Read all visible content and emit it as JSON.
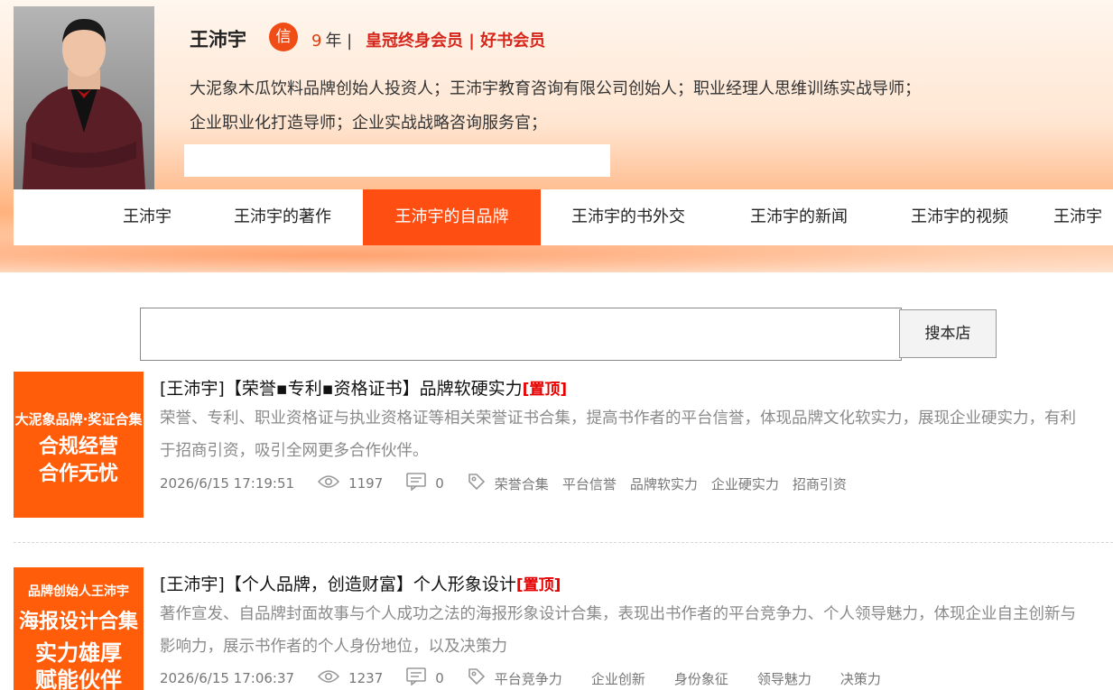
{
  "profile": {
    "name": "王沛宇",
    "credit_badge": "信",
    "years_num": "9",
    "years_unit": "年 |",
    "membership": "皇冠终身会员 | 好书会员",
    "bio_line1": "大泥象木瓜饮料品牌创始人投资人；王沛宇教育咨询有限公司创始人；职业经理人思维训练实战导师；",
    "bio_line2": "企业职业化打造导师；企业实战战略咨询服务官；"
  },
  "nav": {
    "tabs": [
      {
        "label": "王沛宇"
      },
      {
        "label": "王沛宇的著作"
      },
      {
        "label": "王沛宇的自品牌"
      },
      {
        "label": "王沛宇的书外交"
      },
      {
        "label": "王沛宇的新闻"
      },
      {
        "label": "王沛宇的视频"
      },
      {
        "label": "王沛宇"
      }
    ],
    "active_index": 2
  },
  "search": {
    "value": "",
    "button_label": "搜本店"
  },
  "items": [
    {
      "thumb_line1": "大泥象品牌·奖证合集",
      "thumb_line2": "合规经营",
      "thumb_line3": "合作无忧",
      "title": "[王沛宇]【荣誉▪专利▪资格证书】品牌软硬实力",
      "pin": "[置顶]",
      "desc": "荣誉、专利、职业资格证与执业资格证等相关荣誉证书合集，提高书作者的平台信誉，体现品牌文化软实力，展现企业硬实力，有利于招商引资，吸引全网更多合作伙伴。",
      "date": "2026/6/15 17:19:51",
      "views": "1197",
      "comments": "0",
      "tags": [
        "荣誉合集",
        "平台信誉",
        "品牌软实力",
        "企业硬实力",
        "招商引资"
      ]
    },
    {
      "thumb_line1": "品牌创始人王沛宇",
      "thumb_line2": "海报设计合集",
      "thumb_line3": "实力雄厚",
      "thumb_line4": "赋能伙伴",
      "title": "[王沛宇]【个人品牌，创造财富】个人形象设计",
      "pin": "[置顶]",
      "desc": "著作宣发、自品牌封面故事与个人成功之法的海报形象设计合集，表现出书作者的平台竞争力、个人领导魅力，体现企业自主创新与影响力，展示书作者的个人身份地位，以及决策力",
      "date": "2026/6/15 17:06:37",
      "views": "1237",
      "comments": "0",
      "tags": [
        "平台竞争力",
        "企业创新",
        "身份象征",
        "领导魅力",
        "决策力"
      ]
    }
  ],
  "colors": {
    "accent": "#ff4e12",
    "pin_red": "#e60000",
    "member_red": "#d6261b"
  }
}
